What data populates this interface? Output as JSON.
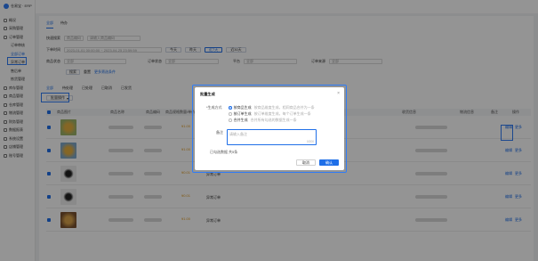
{
  "app": {
    "title": "仓易宝 · ERP"
  },
  "sidebar": {
    "items": [
      {
        "label": "概况"
      },
      {
        "label": "采购管理"
      },
      {
        "label": "订单管理"
      },
      {
        "label": "订单审核"
      },
      {
        "label": "全部订单"
      },
      {
        "label": "异常订单"
      },
      {
        "label": "售后单"
      },
      {
        "label": "拣货管理"
      },
      {
        "label": "库存管理"
      },
      {
        "label": "商品管理"
      },
      {
        "label": "仓库管理"
      },
      {
        "label": "物流管理"
      },
      {
        "label": "财务管理"
      },
      {
        "label": "数据报表"
      },
      {
        "label": "系统设置"
      },
      {
        "label": "店铺管理"
      },
      {
        "label": "账号管理"
      }
    ]
  },
  "content": {
    "tabs": [
      {
        "label": "全部"
      },
      {
        "label": "待办"
      }
    ],
    "filters": {
      "row1": {
        "label": "快速搜索",
        "type": "商品编码",
        "placeholder": "请输入商品编码"
      },
      "row2": {
        "label": "下单时间",
        "range": "2023-01-01 00:00:00 ~ 2023-04-25 23:59:59",
        "btn_today": "今天",
        "btn_yesterday": "昨天",
        "btn_7d": "近7天",
        "btn_30d": "近30天"
      },
      "row3": {
        "shop_label": "商品状态",
        "shop_value": "全部",
        "store_label": "订单状态",
        "store_value": "全部",
        "platform_label": "平台",
        "platform_value": "全部",
        "source_label": "订单来源",
        "source_value": "全部"
      },
      "actions": {
        "search": "搜索",
        "reset": "重置",
        "advanced": "更多筛选条件"
      }
    },
    "subtabs": [
      {
        "label": "全部"
      },
      {
        "label": "待处理"
      },
      {
        "label": "已处理"
      },
      {
        "label": "已取消"
      },
      {
        "label": "已发货"
      }
    ],
    "batch_button": "批量操作",
    "columns": [
      "商品图片",
      "商品名称",
      "商品编码",
      "商品规格",
      "数量/单价",
      "订单编号",
      "店铺",
      "平台",
      "收货信息",
      "物流信息",
      "备注",
      "操作"
    ],
    "rows": [
      {
        "price": "¥1.00",
        "status": "",
        "action_edit": "编辑",
        "action_more": "更多"
      },
      {
        "price": "¥1.00",
        "status": "",
        "action_edit": "编辑",
        "action_more": "更多"
      },
      {
        "price": "¥0.01",
        "status": "异常订单",
        "action_edit": "编辑",
        "action_more": "更多"
      },
      {
        "price": "¥0.01",
        "status": "异常订单",
        "action_edit": "编辑",
        "action_more": "更多"
      },
      {
        "price": "¥1.00",
        "status": "异常订单",
        "action_edit": "编辑",
        "action_more": "更多"
      }
    ]
  },
  "modal": {
    "title": "批量生成",
    "field_type_label": "*生成方式",
    "options": [
      {
        "label": "按商品生成",
        "hint": "按商品维度生成，相同商品合并为一条"
      },
      {
        "label": "按订单生成",
        "hint": "按订单维度生成，每个订单生成一条"
      },
      {
        "label": "合并生成",
        "hint": "合并所有勾选的数据生成一条"
      }
    ],
    "remark_label": "备注",
    "remark_placeholder": "请输入备注",
    "remark_counter": "0/200",
    "count_label": "已勾选数据",
    "count_value": "共5条",
    "cancel": "取消",
    "confirm": "确认"
  }
}
